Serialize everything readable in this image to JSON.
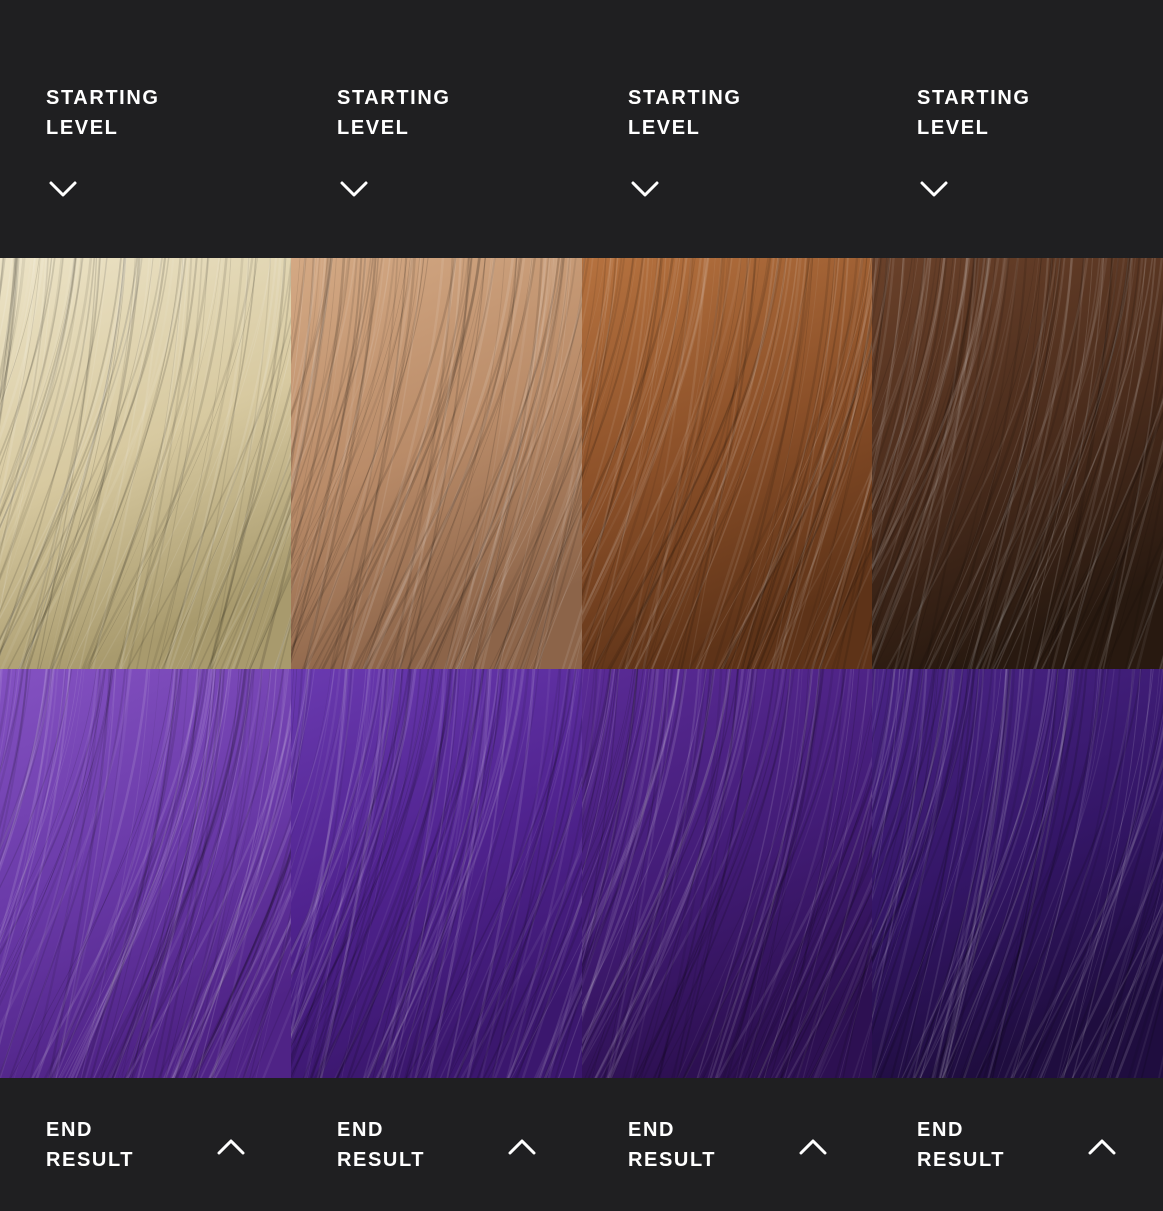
{
  "columns": [
    {
      "start_label": [
        "STARTING",
        "LEVEL"
      ],
      "end_label": [
        "END",
        "RESULT"
      ],
      "start_colors": [
        "#ece3c6",
        "#d7c9a0",
        "#a89a6d"
      ],
      "end_colors": [
        "#8452c2",
        "#6a3aa8",
        "#4f2386"
      ]
    },
    {
      "start_label": [
        "STARTING",
        "LEVEL"
      ],
      "end_label": [
        "END",
        "RESULT"
      ],
      "start_colors": [
        "#d4a984",
        "#b98b68",
        "#8c6449"
      ],
      "end_colors": [
        "#6a3ab0",
        "#50238f",
        "#3b176e"
      ]
    },
    {
      "start_label": [
        "STARTING",
        "LEVEL"
      ],
      "end_label": [
        "END",
        "RESULT"
      ],
      "start_colors": [
        "#b6723f",
        "#8a4f28",
        "#5e3318"
      ],
      "end_colors": [
        "#5a2b96",
        "#431c77",
        "#2d1052"
      ]
    },
    {
      "start_label": [
        "STARTING",
        "LEVEL"
      ],
      "end_label": [
        "END",
        "RESULT"
      ],
      "start_colors": [
        "#6a412a",
        "#4a2c1c",
        "#281910"
      ],
      "end_colors": [
        "#4a2486",
        "#341667",
        "#1f0d3f"
      ]
    }
  ],
  "icons": {
    "header": "chevron-down-icon",
    "footer": "chevron-up-icon"
  }
}
